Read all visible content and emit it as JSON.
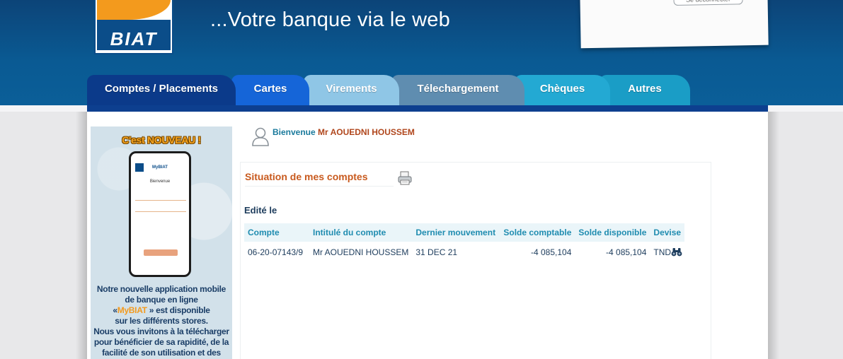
{
  "header": {
    "logo_text": "BIAT",
    "tagline": "...Votre banque via le web",
    "paper_button": "Se déconnecter"
  },
  "tabs": [
    {
      "label": "Comptes / Placements",
      "color": "#0b3a8a"
    },
    {
      "label": "Cartes",
      "color": "#1565d8"
    },
    {
      "label": "Virements",
      "color": "#8fc6e6"
    },
    {
      "label": "Télechargement",
      "color": "#5f8db0"
    },
    {
      "label": "Chèques",
      "color": "#23a9d3"
    },
    {
      "label": "Autres",
      "color": "#1a9dc6"
    }
  ],
  "promo": {
    "title": "C'est NOUVEAU !",
    "phone_app": "MyBIAT",
    "phone_welcome": "Bienvenue",
    "line1": "Notre nouvelle application mobile",
    "line2": "de banque en ligne",
    "line3_pre": "«",
    "line3_brand": "MyBIAT",
    "line3_post": " » est disponible",
    "line4": "sur les différents stores.",
    "line5": "Nous vous invitons à la télécharger",
    "line6": "pour bénéficier de sa rapidité, de la",
    "line7": "facilité de son utilisation et des"
  },
  "welcome": {
    "greeting": "Bienvenue",
    "name": "Mr AOUEDNI HOUSSEM"
  },
  "accounts": {
    "title": "Situation de mes comptes",
    "edited": "Edité le",
    "columns": [
      "Compte",
      "Intitulé du compte",
      "Dernier mouvement",
      "Solde comptable",
      "Solde disponible",
      "Devise"
    ],
    "rows": [
      {
        "account": "06-20-07143/9",
        "holder": "Mr AOUEDNI HOUSSEM",
        "last_movement": "31 DEC 21",
        "book_balance": "-4 085,104",
        "available_balance": "-4 085,104",
        "currency": "TND"
      }
    ]
  }
}
